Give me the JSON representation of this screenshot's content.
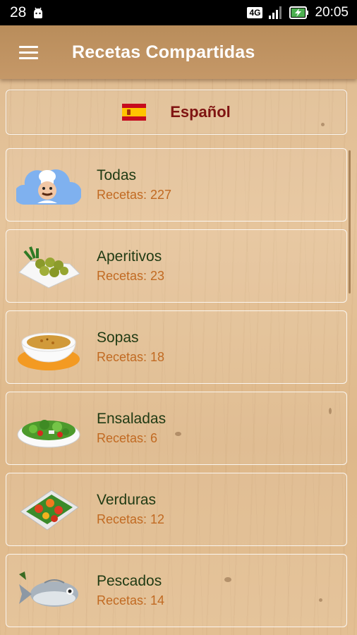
{
  "status_bar": {
    "left_number": "28",
    "network": "4G",
    "time": "20:05"
  },
  "header": {
    "title": "Recetas Compartidas",
    "menu_icon": "hamburger-menu-icon"
  },
  "language": {
    "label": "Español",
    "flag_icon": "spain-flag-icon"
  },
  "categories": [
    {
      "name": "Todas",
      "count": "Recetas: 227",
      "icon": "chef-cloud-icon"
    },
    {
      "name": "Aperitivos",
      "count": "Recetas: 23",
      "icon": "olives-icon"
    },
    {
      "name": "Sopas",
      "count": "Recetas: 18",
      "icon": "soup-bowl-icon"
    },
    {
      "name": "Ensaladas",
      "count": "Recetas: 6",
      "icon": "salad-icon"
    },
    {
      "name": "Verduras",
      "count": "Recetas: 12",
      "icon": "vegetables-icon"
    },
    {
      "name": "Pescados",
      "count": "Recetas: 14",
      "icon": "fish-icon"
    }
  ],
  "colors": {
    "title_text": "#ffffff",
    "language_text": "#7f1412",
    "category_name": "#1f3a13",
    "category_count": "#c16a22"
  }
}
